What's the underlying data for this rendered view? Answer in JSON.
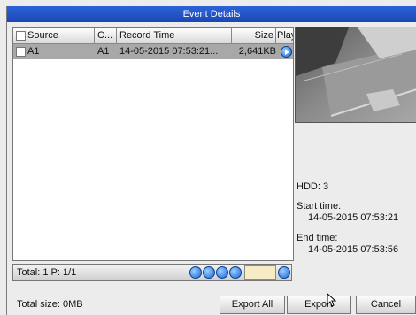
{
  "window": {
    "title": "Event Details"
  },
  "table": {
    "headers": {
      "source": "Source",
      "channel": "C...",
      "record_time": "Record Time",
      "size": "Size",
      "play": "Play"
    },
    "rows": [
      {
        "source": "A1",
        "channel": "A1",
        "record_time": "14-05-2015 07:53:21...",
        "size": "2,641KB"
      }
    ]
  },
  "pager": {
    "status": "Total: 1  P: 1/1",
    "page_input": ""
  },
  "details": {
    "hdd": "HDD: 3",
    "start_label": "Start time:",
    "start_value": "14-05-2015 07:53:21",
    "end_label": "End time:",
    "end_value": "14-05-2015 07:53:56"
  },
  "footer": {
    "total_size": "Total size: 0MB"
  },
  "buttons": {
    "export_all": "Export All",
    "export": "Export",
    "cancel": "Cancel"
  },
  "colors": {
    "titlebar": "#1f4fc4",
    "selected_row": "#a8a8a8",
    "page_box": "#f6edc7"
  }
}
